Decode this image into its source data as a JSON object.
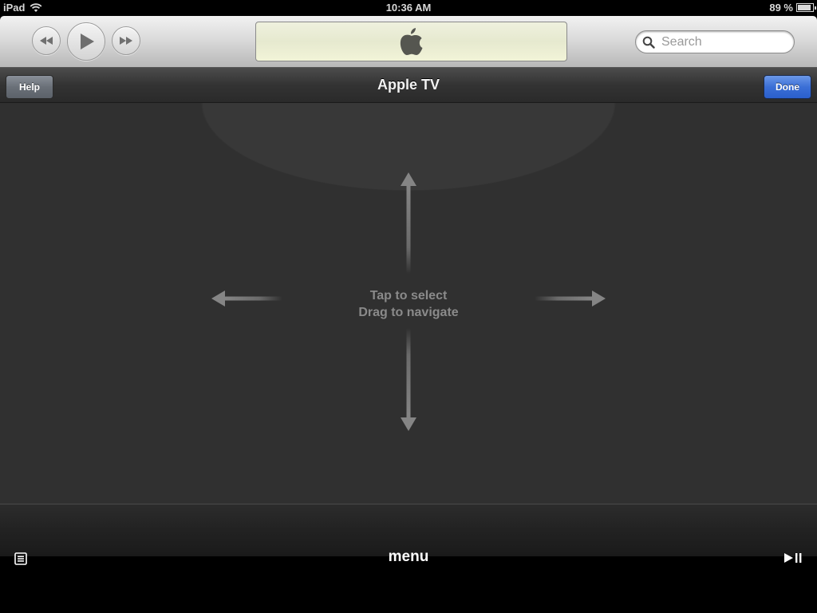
{
  "status_bar": {
    "device": "iPad",
    "time": "10:36 AM",
    "battery_percent_label": "89 %",
    "battery_level": 0.89,
    "icons": [
      "wifi-icon",
      "battery-icon"
    ]
  },
  "player": {
    "buttons": [
      {
        "name": "rewind",
        "icon": "rewind-icon"
      },
      {
        "name": "play",
        "icon": "play-icon"
      },
      {
        "name": "fast-forward",
        "icon": "fast-forward-icon"
      }
    ],
    "display_icon": "apple-logo-icon",
    "search": {
      "placeholder": "Search",
      "value": ""
    }
  },
  "nav": {
    "title": "Apple TV",
    "left_button": "Help",
    "right_button": "Done",
    "done_color": "#3b6fd6"
  },
  "touchpad": {
    "line1": "Tap to select",
    "line2": "Drag to navigate",
    "arrows": [
      "up",
      "down",
      "left",
      "right"
    ]
  },
  "bottom": {
    "menu_label": "menu",
    "left_icon": "list-icon",
    "right_icon": "play-pause-icon"
  }
}
